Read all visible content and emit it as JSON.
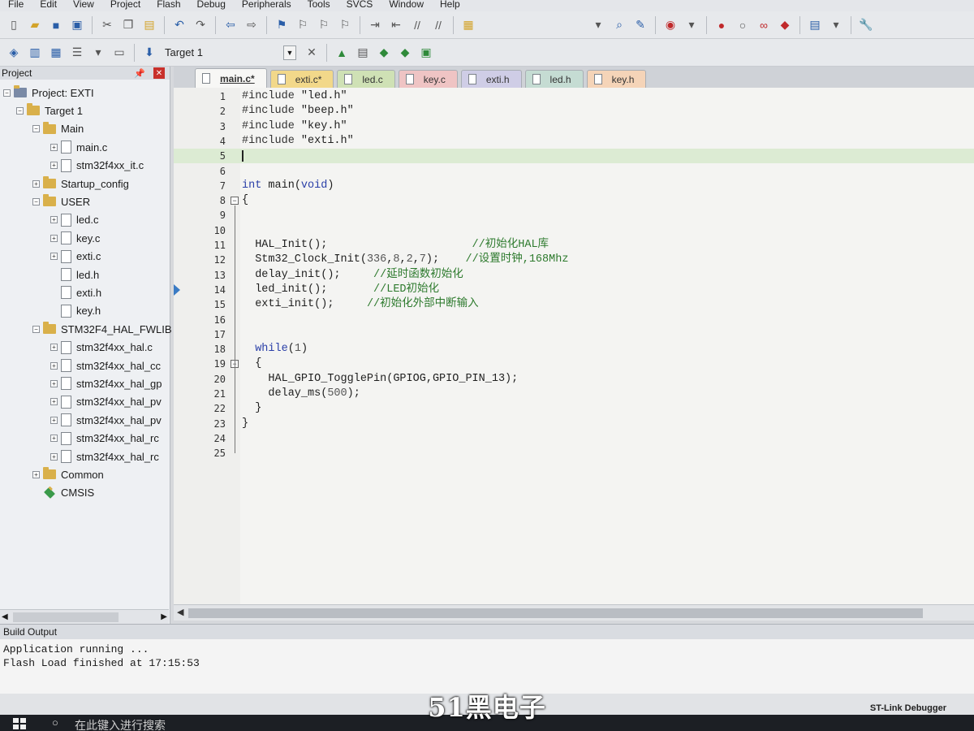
{
  "menu": [
    "File",
    "Edit",
    "View",
    "Project",
    "Flash",
    "Debug",
    "Peripherals",
    "Tools",
    "SVCS",
    "Window",
    "Help"
  ],
  "toolbar2": {
    "target": "Target 1"
  },
  "project_panel": {
    "title": "Project",
    "tree": [
      {
        "label": "Project: EXTI",
        "kind": "root",
        "depth": 0,
        "pm": "−"
      },
      {
        "label": "Target 1",
        "kind": "target",
        "depth": 1,
        "pm": "−"
      },
      {
        "label": "Main",
        "kind": "folder",
        "depth": 2,
        "pm": "−"
      },
      {
        "label": "main.c",
        "kind": "file",
        "depth": 3,
        "pm": "+"
      },
      {
        "label": "stm32f4xx_it.c",
        "kind": "file",
        "depth": 3,
        "pm": "+"
      },
      {
        "label": "Startup_config",
        "kind": "folder",
        "depth": 2,
        "pm": "+"
      },
      {
        "label": "USER",
        "kind": "folder",
        "depth": 2,
        "pm": "−"
      },
      {
        "label": "led.c",
        "kind": "file",
        "depth": 3,
        "pm": "+"
      },
      {
        "label": "key.c",
        "kind": "file",
        "depth": 3,
        "pm": "+"
      },
      {
        "label": "exti.c",
        "kind": "file",
        "depth": 3,
        "pm": "+"
      },
      {
        "label": "led.h",
        "kind": "file",
        "depth": 3,
        "pm": ""
      },
      {
        "label": "exti.h",
        "kind": "file",
        "depth": 3,
        "pm": ""
      },
      {
        "label": "key.h",
        "kind": "file",
        "depth": 3,
        "pm": ""
      },
      {
        "label": "STM32F4_HAL_FWLIB",
        "kind": "folder",
        "depth": 2,
        "pm": "−"
      },
      {
        "label": "stm32f4xx_hal.c",
        "kind": "file",
        "depth": 3,
        "pm": "+"
      },
      {
        "label": "stm32f4xx_hal_cc",
        "kind": "file",
        "depth": 3,
        "pm": "+"
      },
      {
        "label": "stm32f4xx_hal_gp",
        "kind": "file",
        "depth": 3,
        "pm": "+"
      },
      {
        "label": "stm32f4xx_hal_pv",
        "kind": "file",
        "depth": 3,
        "pm": "+"
      },
      {
        "label": "stm32f4xx_hal_pv",
        "kind": "file",
        "depth": 3,
        "pm": "+"
      },
      {
        "label": "stm32f4xx_hal_rc",
        "kind": "file",
        "depth": 3,
        "pm": "+"
      },
      {
        "label": "stm32f4xx_hal_rc",
        "kind": "file",
        "depth": 3,
        "pm": "+"
      },
      {
        "label": "Common",
        "kind": "folder",
        "depth": 2,
        "pm": "+"
      },
      {
        "label": "CMSIS",
        "kind": "cmsis",
        "depth": 2,
        "pm": ""
      }
    ]
  },
  "tabs": [
    {
      "label": "main.c*",
      "cls": "active"
    },
    {
      "label": "exti.c*",
      "cls": "c-exti"
    },
    {
      "label": "led.c",
      "cls": "c-led"
    },
    {
      "label": "key.c",
      "cls": "c-key"
    },
    {
      "label": "exti.h",
      "cls": "c-extih"
    },
    {
      "label": "led.h",
      "cls": "c-ledh"
    },
    {
      "label": "key.h",
      "cls": "c-keyh"
    }
  ],
  "code_lines": [
    {
      "n": "1",
      "html": "<span class='pp'>#include</span> <span class='str'>\"led.h\"</span>"
    },
    {
      "n": "2",
      "html": "<span class='pp'>#include</span> <span class='str'>\"beep.h\"</span>"
    },
    {
      "n": "3",
      "html": "<span class='pp'>#include</span> <span class='str'>\"key.h\"</span>"
    },
    {
      "n": "4",
      "html": "<span class='pp'>#include</span> <span class='str'>\"exti.h\"</span>"
    },
    {
      "n": "5",
      "html": "",
      "highlight": true
    },
    {
      "n": "6",
      "html": ""
    },
    {
      "n": "7",
      "html": "<span class='kw'>int</span> main(<span class='kw'>void</span>)"
    },
    {
      "n": "8",
      "html": "{"
    },
    {
      "n": "9",
      "html": ""
    },
    {
      "n": "10",
      "html": ""
    },
    {
      "n": "11",
      "html": "  HAL_Init();                      <span class='cm'>//初始化HAL库</span>"
    },
    {
      "n": "12",
      "html": "  Stm32_Clock_Init(<span class='num'>336</span>,<span class='num'>8</span>,<span class='num'>2</span>,<span class='num'>7</span>);    <span class='cm'>//设置时钟,168Mhz</span>"
    },
    {
      "n": "13",
      "html": "  delay_init();     <span class='cm'>//延时函数初始化</span>"
    },
    {
      "n": "14",
      "html": "  led_init();       <span class='cm'>//LED初始化</span>"
    },
    {
      "n": "15",
      "html": "  exti_init();     <span class='cm'>//初始化外部中断输入</span>"
    },
    {
      "n": "16",
      "html": ""
    },
    {
      "n": "17",
      "html": ""
    },
    {
      "n": "18",
      "html": "  <span class='kw'>while</span>(<span class='num'>1</span>)"
    },
    {
      "n": "19",
      "html": "  {"
    },
    {
      "n": "20",
      "html": "    HAL_GPIO_TogglePin(GPIOG,GPIO_PIN_13);"
    },
    {
      "n": "21",
      "html": "    delay_ms(<span class='num'>500</span>);"
    },
    {
      "n": "22",
      "html": "  }"
    },
    {
      "n": "23",
      "html": "}"
    },
    {
      "n": "24",
      "html": ""
    },
    {
      "n": "25",
      "html": ""
    }
  ],
  "build_output": {
    "title": "Build Output",
    "text": "Application running ...\nFlash Load finished at 17:15:53"
  },
  "status": {
    "debugger": "ST-Link Debugger"
  },
  "watermark": "51黑电子",
  "taskbar": {
    "search_placeholder": "在此键入进行搜索"
  }
}
